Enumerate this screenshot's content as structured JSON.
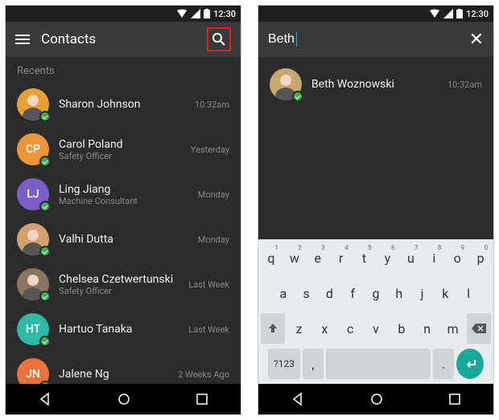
{
  "status": {
    "time": "12:30"
  },
  "left": {
    "title": "Contacts",
    "section": "Recents",
    "items": [
      {
        "name": "Sharon Johnson",
        "sub": "",
        "time": "10:32am",
        "avatar": {
          "type": "photo",
          "bg": "#e8a035"
        }
      },
      {
        "name": "Carol Poland",
        "sub": "Safety Officer",
        "time": "Yesterday",
        "avatar": {
          "type": "initials",
          "text": "CP",
          "bg": "#f0953a"
        }
      },
      {
        "name": "Ling Jiang",
        "sub": "Machine Consultant",
        "time": "Monday",
        "avatar": {
          "type": "initials",
          "text": "LJ",
          "bg": "#7b5fc9"
        }
      },
      {
        "name": "Valhi Dutta",
        "sub": "",
        "time": "Monday",
        "avatar": {
          "type": "photo",
          "bg": "#d4a070"
        }
      },
      {
        "name": "Chelsea Czetwertunski",
        "sub": "Safety Officer",
        "time": "Last Week",
        "avatar": {
          "type": "photo",
          "bg": "#8a7560"
        }
      },
      {
        "name": "Hartuo Tanaka",
        "sub": "",
        "time": "Last Week",
        "avatar": {
          "type": "initials",
          "text": "HT",
          "bg": "#2bb9a8"
        }
      },
      {
        "name": "Jalene Ng",
        "sub": "",
        "time": "2 Weeks Ago",
        "avatar": {
          "type": "initials",
          "text": "JN",
          "bg": "#e8743b"
        }
      }
    ]
  },
  "right": {
    "query": "Beth",
    "close": "✕",
    "results": [
      {
        "name": "Beth Woznowski",
        "time": "10:32am",
        "avatar": {
          "type": "photo",
          "bg": "#c9a870"
        }
      }
    ],
    "keyboard": {
      "row1": [
        {
          "k": "q",
          "n": "1"
        },
        {
          "k": "w",
          "n": "2"
        },
        {
          "k": "e",
          "n": "3"
        },
        {
          "k": "r",
          "n": "4"
        },
        {
          "k": "t",
          "n": "5"
        },
        {
          "k": "y",
          "n": "6"
        },
        {
          "k": "u",
          "n": "7"
        },
        {
          "k": "i",
          "n": "8"
        },
        {
          "k": "o",
          "n": "9"
        },
        {
          "k": "p",
          "n": "0"
        }
      ],
      "row2": [
        "a",
        "s",
        "d",
        "f",
        "g",
        "h",
        "j",
        "k",
        "l"
      ],
      "row3": [
        "z",
        "x",
        "c",
        "v",
        "b",
        "n",
        "m"
      ],
      "numlabel": "?123",
      "comma": ",",
      "period": "."
    }
  }
}
